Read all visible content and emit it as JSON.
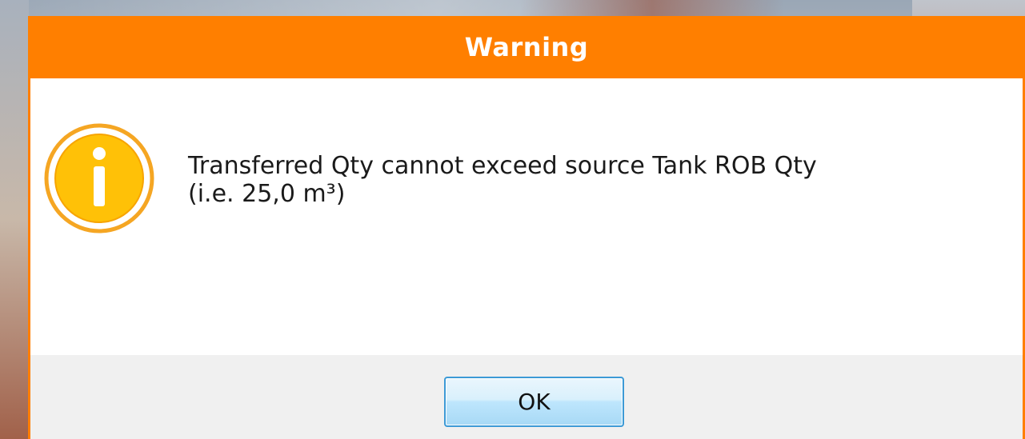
{
  "dialog": {
    "title": "Warning",
    "icon": "info-icon",
    "message_line1": "Transferred Qty cannot exceed source Tank ROB Qty",
    "message_line2": "(i.e. 25,0 m³)",
    "ok_label": "OK"
  },
  "colors": {
    "title_bar": "#ff7f00",
    "icon_ring": "#f5a623",
    "icon_fill": "#ffc107",
    "button_border": "#3c9ad6"
  }
}
